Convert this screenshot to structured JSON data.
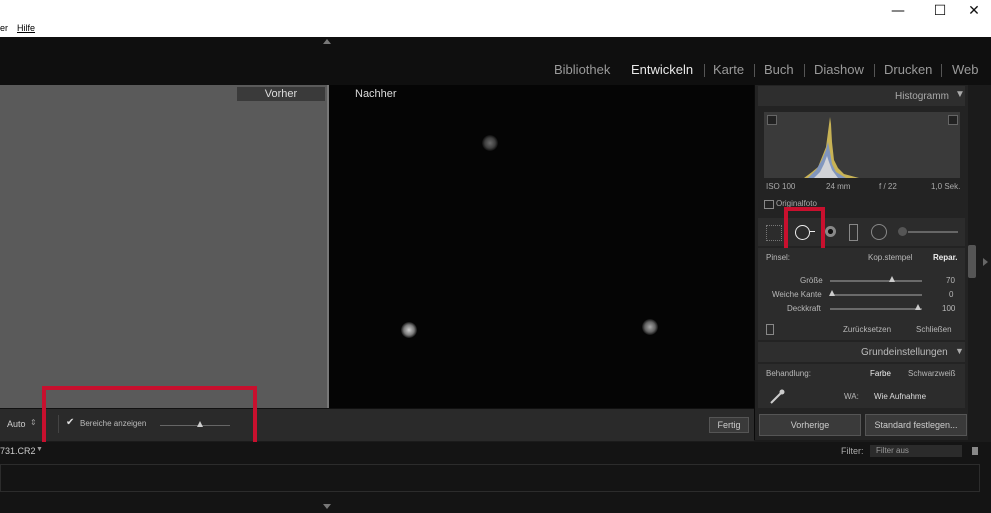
{
  "menu": {
    "items": [
      "er",
      "Hilfe"
    ]
  },
  "window_controls": {
    "minimize": "—",
    "maximize": "☐",
    "close": "✕"
  },
  "modules": [
    "Bibliothek",
    "Entwickeln",
    "Karte",
    "Buch",
    "Diashow",
    "Drucken",
    "Web"
  ],
  "active_module": "Entwickeln",
  "views": {
    "before": "Vorher",
    "after": "Nachher"
  },
  "histogram": {
    "title": "Histogramm",
    "iso": "ISO 100",
    "focal": "24 mm",
    "aperture": "f / 22",
    "shutter": "1,0 Sek.",
    "original_label": "Originalfoto"
  },
  "brush": {
    "label": "Pinsel:",
    "mode_clone": "Kop.stempel",
    "mode_heal": "Repar.",
    "rows": [
      {
        "label": "Größe",
        "value": "70"
      },
      {
        "label": "Weiche Kante",
        "value": "0"
      },
      {
        "label": "Deckkraft",
        "value": "100"
      }
    ],
    "reset": "Zurücksetzen",
    "close": "Schließen"
  },
  "basic": {
    "title": "Grundeinstellungen",
    "treatment_label": "Behandlung:",
    "treatment_color": "Farbe",
    "treatment_bw": "Schwarzweiß",
    "wb_label": "WA:",
    "wb_value": "Wie Aufnahme"
  },
  "buttons": {
    "previous": "Vorherige",
    "set_default": "Standard festlegen...",
    "done": "Fertig"
  },
  "toolbar": {
    "auto": "Auto",
    "show_spots": "Bereiche anzeigen",
    "show_spots_checked": true
  },
  "filmstrip": {
    "filename": "731.CR2",
    "filter_label": "Filter:",
    "filter_value": "Filter aus"
  },
  "colors": {
    "highlight": "#c8102e",
    "panel": "#232323",
    "after_bg": "#050505",
    "before_bg": "#5a5a5a"
  }
}
